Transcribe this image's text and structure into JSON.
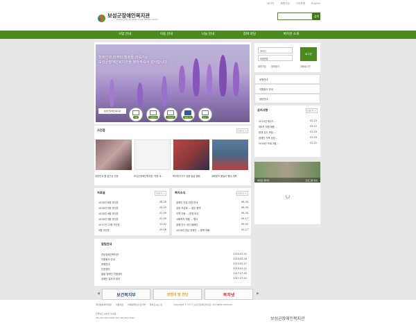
{
  "top_links": [
    "로그인",
    "회원가입",
    "사이트맵",
    "English"
  ],
  "logo": {
    "title": "보성군장애인복지관",
    "subtitle": "Boseong Handicapped Social Welfare Center"
  },
  "search": {
    "placeholder": "",
    "button": "검색"
  },
  "nav": [
    "사업 안내",
    "이용 안내",
    "나눔 안내",
    "참여 마당",
    "복지관 소개"
  ],
  "hero": {
    "line1": "장애인과 지역이 행복을 키워가는",
    "line2": "보성군장애인복지관을 찾아주셔서 감사합니다.",
    "caption": "보성군장애인복지관"
  },
  "quick": [
    "후원",
    "자원봉사",
    "공지사항",
    "페이스북",
    "블로그"
  ],
  "login": {
    "id_placeholder": "아이디",
    "pw_placeholder": "비밀번호",
    "button": "로그인",
    "join": "회원가입",
    "find": "정보찾기",
    "keep": "자동로그인"
  },
  "side_menu": [
    "후원안내",
    "자원봉사 안내",
    "상담안내"
  ],
  "notice": {
    "title": "공지사항",
    "more": "더보기 +",
    "items": [
      {
        "t": "2019년 제2차 ...",
        "d": "02-23"
      },
      {
        "t": "제9차 직원 채용 ...",
        "d": "02-12"
      },
      {
        "t": "현재 강사 모집 ...",
        "d": "01-29"
      },
      {
        "t": "장애인 가족 상담...",
        "d": "01-29"
      },
      {
        "t": "2018년 프로그램...",
        "d": "01-01"
      }
    ]
  },
  "side_photo": {
    "left": "복지관 갤러리",
    "right": "프로그램 영상"
  },
  "gallery": {
    "title": "사진첩",
    "more": "더보기 +",
    "items": [
      "대한민국 웹 접근성 인증",
      "보성군장애인복지관 '직원 내...",
      "복지위기가구 집중 발굴 캠페",
      "새해맞이 윷놀이 행사 개최"
    ]
  },
  "meeting": {
    "title": "자료실",
    "more": "더보기 +",
    "items": [
      {
        "t": "2018년 6월 식단표",
        "d": "06-28"
      },
      {
        "t": "2018년 5월 식단표",
        "d": "04-25"
      },
      {
        "t": "2018년 4월 식단표",
        "d": "02-09"
      },
      {
        "t": "2018년 3월 식단표",
        "d": "02-09"
      },
      {
        "t": "2017년 11월 식단표",
        "d": "11-02"
      },
      {
        "t": "9월 식단표",
        "d": "09-16"
      }
    ]
  },
  "board": {
    "title": "복지소식",
    "more": "더보기 +",
    "items": [
      {
        "t": "장애인 연금 관련 안내",
        "d": "08-30"
      },
      {
        "t": "공동 모금회 ... 업무 협약",
        "d": "08-30"
      },
      {
        "t": "지역 아동 ... 운영 보고",
        "d": "06-30"
      },
      {
        "t": "사회복지 체험 ... 행사",
        "d": "04-17"
      },
      {
        "t": "장애 인식 개선 캠페인",
        "d": "09-05"
      },
      {
        "t": "2018년 전남 장애인 ... 종목 대회",
        "d": "02-27"
      }
    ]
  },
  "related": {
    "title": "알림안내",
    "more": "더보기 +",
    "items": [
      {
        "t": "전남장애인복지관",
        "d": "2019-02-01"
      },
      {
        "t": "자원봉사 안내",
        "d": "2019-02-28"
      },
      {
        "t": "후원안내",
        "d": "2019-02-27"
      },
      {
        "t": "인권센터",
        "d": "2019-01-22"
      },
      {
        "t": "발달 장애인 지원센터",
        "d": "2017-07-05"
      },
      {
        "t": "장애인 일자리 센터",
        "d": "2017-07-01"
      }
    ]
  },
  "banners": [
    "보건복지부",
    "생명의 땅 전남",
    "복지넷"
  ],
  "footer": {
    "links": [
      "개인정보처리방침",
      "이용약관",
      "이메일무단수집거부",
      "찾아오시는 길"
    ],
    "copy": "Copyright © 2017 보성군장애인복지관. All rights reserved.",
    "addr1": "전라남도 보성군 보성읍 ...",
    "addr2": "TEL 061-852-0091  FAX 061-852-0092",
    "logo": "보성군장애인복지관"
  },
  "colors": {
    "brand": "#4b8a1f",
    "accent": "#3f7a14"
  }
}
